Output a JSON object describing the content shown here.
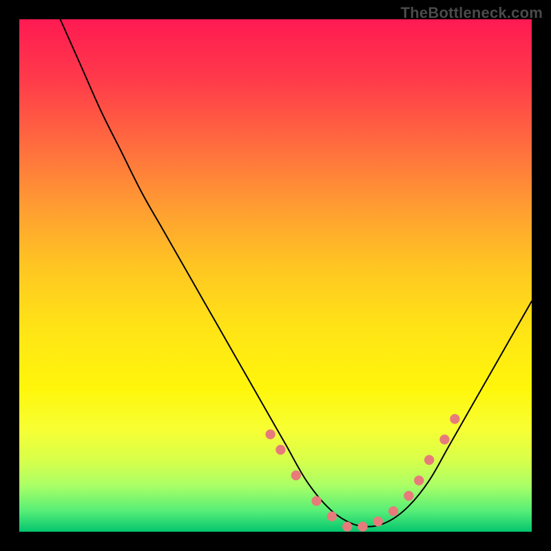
{
  "watermark": {
    "text": "TheBottleneck.com"
  },
  "chart_data": {
    "type": "line",
    "title": "",
    "xlabel": "",
    "ylabel": "",
    "xlim": [
      0,
      100
    ],
    "ylim": [
      0,
      100
    ],
    "grid": false,
    "legend": false,
    "series": [
      {
        "name": "bottleneck-curve",
        "color": "#000000",
        "x": [
          8,
          12,
          16,
          20,
          24,
          28,
          32,
          36,
          40,
          44,
          48,
          52,
          56,
          60,
          64,
          68,
          72,
          76,
          80,
          84,
          88,
          92,
          96,
          100
        ],
        "y": [
          100,
          91,
          82,
          74,
          66,
          59,
          52,
          45,
          38,
          31,
          24,
          17,
          10,
          5,
          2,
          1,
          2,
          5,
          10,
          17,
          24,
          31,
          38,
          45
        ]
      },
      {
        "name": "highlight-markers",
        "color": "#e77b7b",
        "type": "scatter",
        "x": [
          49,
          51,
          54,
          58,
          61,
          64,
          67,
          70,
          73,
          76,
          78,
          80,
          83,
          85
        ],
        "y": [
          19,
          16,
          11,
          6,
          3,
          1,
          1,
          2,
          4,
          7,
          10,
          14,
          18,
          22
        ]
      }
    ]
  }
}
